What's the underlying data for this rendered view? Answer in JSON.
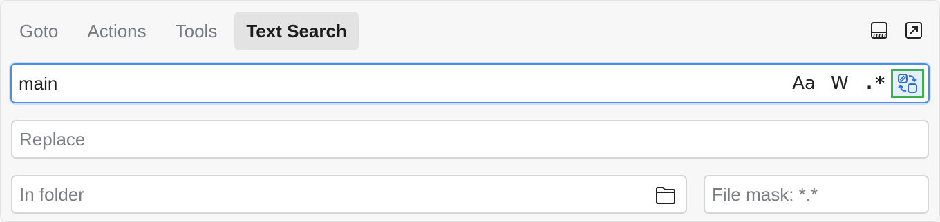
{
  "tabs": [
    {
      "label": "Goto",
      "active": false
    },
    {
      "label": "Actions",
      "active": false
    },
    {
      "label": "Tools",
      "active": false
    },
    {
      "label": "Text Search",
      "active": true
    }
  ],
  "header_icons": [
    "dock-bottom-icon",
    "open-external-icon"
  ],
  "search": {
    "value": "main",
    "placeholder": "",
    "options": {
      "match_case_label": "Aa",
      "whole_word_label": "W",
      "regex_label": ".*",
      "replace_toggle_icon": "replace-toggle-icon"
    }
  },
  "replace": {
    "value": "",
    "placeholder": "Replace"
  },
  "folder": {
    "value": "",
    "placeholder": "In folder",
    "icon": "folder-icon"
  },
  "file_mask": {
    "value": "",
    "placeholder": "File mask: *.*"
  },
  "colors": {
    "accent": "#4a8ee6",
    "highlight_border": "#3fae51",
    "active_tab_bg": "#e3e3e4"
  }
}
